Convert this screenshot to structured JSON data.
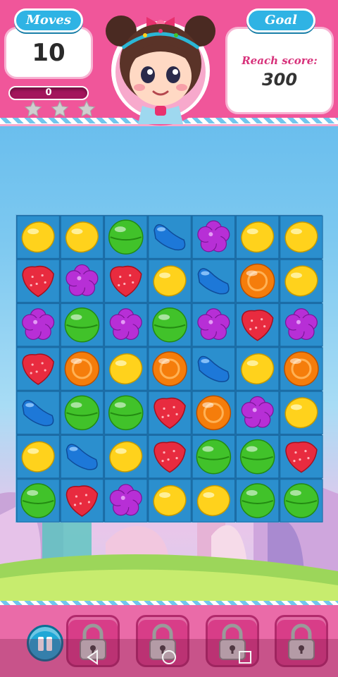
{
  "hud": {
    "moves_label": "Moves",
    "moves_value": "10",
    "goal_label": "Goal",
    "goal_text": "Reach score:",
    "goal_score": "300",
    "score_value": "0",
    "score_progress": 0,
    "stars_earned": 0,
    "stars_total": 3
  },
  "board": {
    "rows": 7,
    "cols": 7,
    "grid": [
      [
        "yellow",
        "yellow",
        "green",
        "blue",
        "purple",
        "yellow",
        "yellow"
      ],
      [
        "red",
        "purple",
        "red",
        "yellow",
        "blue",
        "orange",
        "yellow"
      ],
      [
        "purple",
        "green",
        "purple",
        "green",
        "purple",
        "red",
        "purple"
      ],
      [
        "red",
        "orange",
        "yellow",
        "orange",
        "blue",
        "yellow",
        "orange"
      ],
      [
        "blue",
        "green",
        "green",
        "red",
        "orange",
        "purple",
        "yellow"
      ],
      [
        "yellow",
        "blue",
        "yellow",
        "red",
        "green",
        "green",
        "red"
      ],
      [
        "green",
        "red",
        "purple",
        "yellow",
        "yellow",
        "green",
        "green"
      ]
    ]
  },
  "candy_types": {
    "yellow": {
      "name": "yellow-lemon-candy-icon",
      "color": "#ffd21c"
    },
    "green": {
      "name": "green-round-candy-icon",
      "color": "#41c22a"
    },
    "blue": {
      "name": "blue-jellybean-candy-icon",
      "color": "#1d78d8"
    },
    "purple": {
      "name": "purple-flower-candy-icon",
      "color": "#b72fd6"
    },
    "red": {
      "name": "red-strawberry-candy-icon",
      "color": "#e82b3f"
    },
    "orange": {
      "name": "orange-round-candy-icon",
      "color": "#f57d0b"
    }
  },
  "booster_slots": [
    {
      "icon": "padlock-icon",
      "locked": true
    },
    {
      "icon": "padlock-icon",
      "locked": true
    },
    {
      "icon": "padlock-icon",
      "locked": true
    },
    {
      "icon": "padlock-icon",
      "locked": true
    }
  ],
  "controls": {
    "pause_icon": "pause-icon"
  },
  "nav": {
    "back_icon": "back-triangle-icon",
    "home_icon": "home-circle-icon",
    "recents_icon": "recents-square-icon"
  },
  "colors": {
    "hud_pink": "#f0569a",
    "board_blue": "#1d6fa8",
    "pill_blue": "#2fb3e4",
    "goal_text": "#d7327b"
  }
}
